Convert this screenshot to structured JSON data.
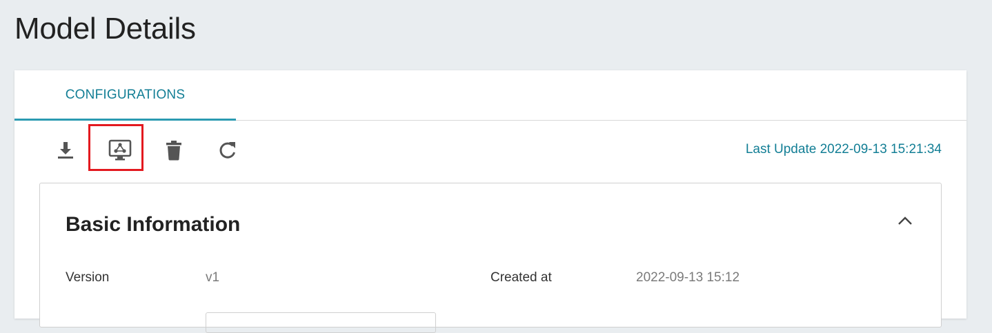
{
  "page": {
    "title": "Model Details"
  },
  "tabs": [
    {
      "label": "CONFIGURATIONS",
      "active": true
    }
  ],
  "toolbar": {
    "buttons": [
      {
        "name": "download",
        "icon": "download-icon"
      },
      {
        "name": "deploy",
        "icon": "monitor-network-icon",
        "highlighted": true
      },
      {
        "name": "delete",
        "icon": "trash-icon"
      },
      {
        "name": "refresh",
        "icon": "refresh-icon"
      }
    ],
    "last_update": "Last Update 2022-09-13 15:21:34"
  },
  "basic_information": {
    "title": "Basic Information",
    "collapse_icon": "chevron-up-icon",
    "fields": {
      "version_label": "Version",
      "version_value": "v1",
      "created_label": "Created at",
      "created_value": "2022-09-13 15:12"
    }
  },
  "colors": {
    "background": "#e9edf0",
    "accent": "#127e95",
    "tab_indicator": "#2b9ab1",
    "highlight": "#e3191f",
    "icon": "#555555"
  }
}
